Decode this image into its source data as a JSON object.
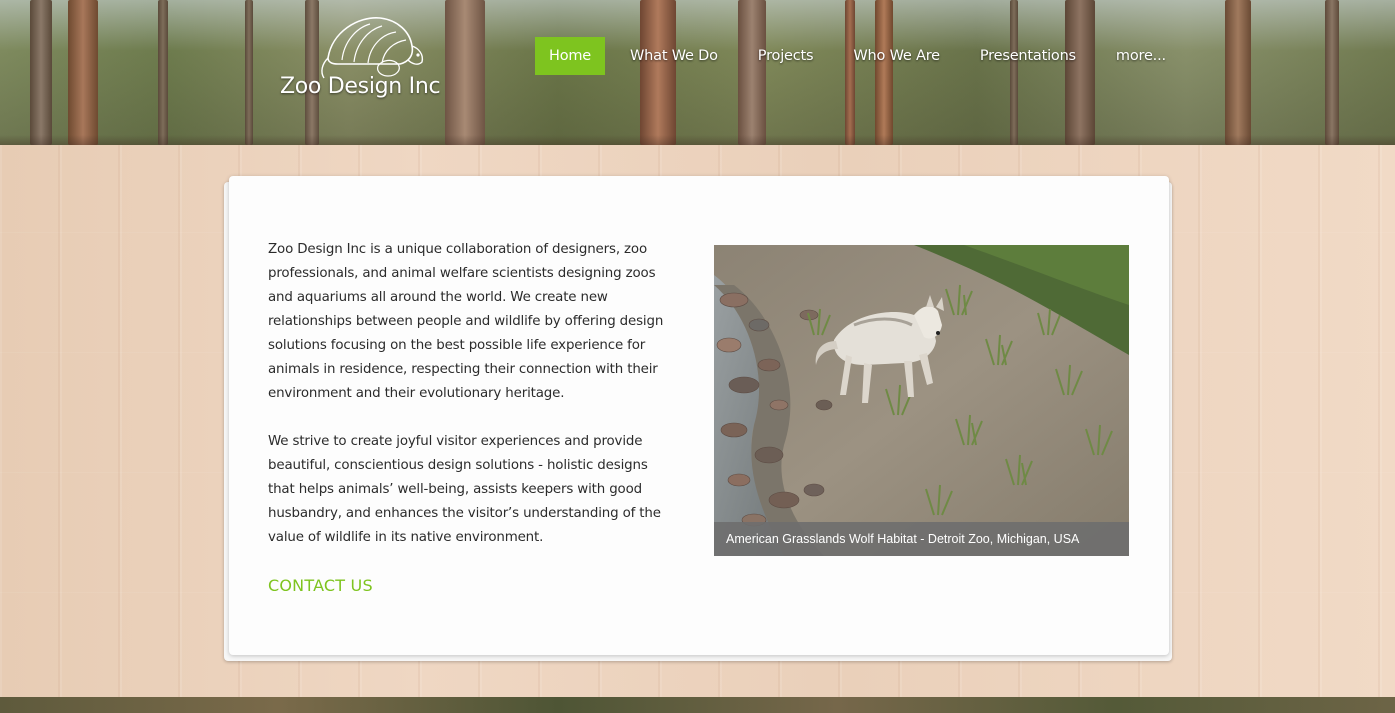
{
  "brand": {
    "name": "Zoo Design Inc",
    "logo_icon": "armadillo-logo-icon"
  },
  "nav": {
    "items": [
      {
        "label": "Home",
        "active": true
      },
      {
        "label": "What We Do",
        "active": false
      },
      {
        "label": "Projects",
        "active": false
      },
      {
        "label": "Who We Are",
        "active": false
      },
      {
        "label": "Presentations",
        "active": false
      },
      {
        "label": "more...",
        "active": false
      }
    ]
  },
  "main": {
    "paragraphs": [
      "Zoo Design Inc is a unique collaboration of designers, zoo professionals, and animal welfare scientists designing zoos and aquariums all around the world. We create new relationships between people and wildlife by offering design solutions focusing on the best possible life experience for animals in residence, respecting their connection with their environment and their evolutionary heritage.",
      "We strive to create joyful visitor experiences and provide beautiful, conscientious design solutions - holistic designs that helps animals’ well-being, assists keepers with good husbandry, and enhances the visitor’s understanding of the value of wildlife in its native environment."
    ],
    "contact_label": "CONTACT US",
    "photo": {
      "caption": "American Grasslands Wolf Habitat - Detroit Zoo, Michigan, USA"
    }
  },
  "colors": {
    "accent": "#7ec41f",
    "card": "#fdfdfd",
    "caption_bg": "#6e6e6e"
  }
}
